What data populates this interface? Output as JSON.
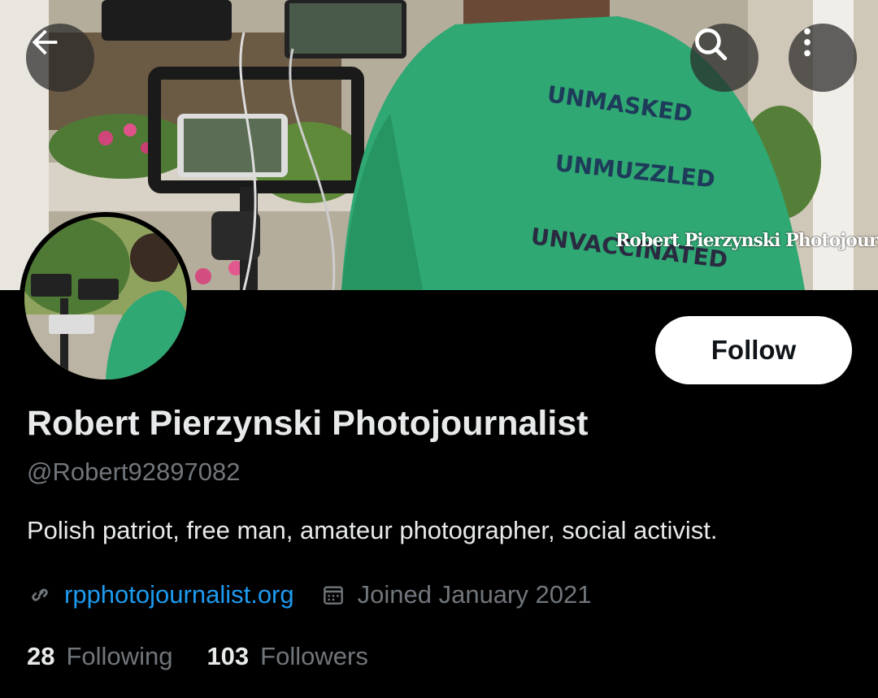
{
  "banner": {
    "shirt_lines": [
      "UNMASKED",
      "UNMUZZLED",
      "UNVACCINATED"
    ],
    "watermark": "Robert Pierzynski Photojournalist"
  },
  "header": {
    "back_icon": "arrow-left-icon",
    "search_icon": "search-icon",
    "more_icon": "more-vertical-icon"
  },
  "profile": {
    "follow_label": "Follow",
    "display_name": "Robert Pierzynski Photojournalist",
    "handle": "@Robert92897082",
    "bio": "Polish patriot, free man, amateur photographer, social activist.",
    "website": "rpphotojournalist.org",
    "joined": "Joined January 2021",
    "following_count": "28",
    "following_label": "Following",
    "followers_count": "103",
    "followers_label": "Followers"
  },
  "colors": {
    "accent": "#1d9bf0",
    "muted": "#71767b",
    "shirt": "#2fa873"
  }
}
